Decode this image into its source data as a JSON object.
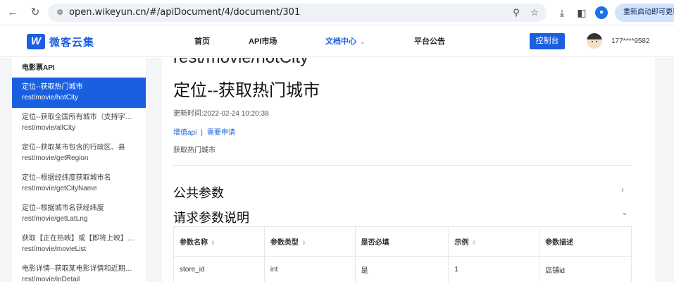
{
  "browser": {
    "url": "open.wikeyun.cn/#/apiDocument/4/document/301",
    "update_button": "重新启动即可更新"
  },
  "header": {
    "logo_mark": "W",
    "logo_text": "微客云集",
    "nav": [
      "首页",
      "API市场",
      "文档中心",
      "平台公告"
    ],
    "console": "控制台",
    "phone": "177****9582"
  },
  "sidebar": {
    "title": "电影票API",
    "items": [
      {
        "title": "定位--获取热门城市",
        "path": "rest/movie/hotCity"
      },
      {
        "title": "定位--获取全国所有城市（支持字母...",
        "path": "rest/movie/allCity"
      },
      {
        "title": "定位--获取某市包含的行政区、县",
        "path": "rest/movie/getRegion"
      },
      {
        "title": "定位--根据经纬度获取城市名",
        "path": "rest/movie/getCityName"
      },
      {
        "title": "定位--根据城市名获经纬度",
        "path": "rest/movie/getLatLng"
      },
      {
        "title": "获取【正在热映】或【即将上映】电...",
        "path": "rest/movie/movieList"
      },
      {
        "title": "电影详情--获取某电影详情和近期所...",
        "path": "rest/movie/inDetail"
      }
    ]
  },
  "doc": {
    "endpoint": "rest/movie/hotCity",
    "title": "定位--获取热门城市",
    "updated": "更新时间:2022-02-24 10:20:38",
    "link_value_api": "增值api",
    "link_separator": "|",
    "link_apply": "需要申请",
    "description": "获取热门城市",
    "section_public": "公共参数",
    "section_request": "请求参数说明",
    "chevron_right": "›",
    "chevron_down": "⌄"
  },
  "table": {
    "headers": [
      "参数名称",
      "参数类型",
      "是否必填",
      "示例",
      "参数描述"
    ],
    "rows": [
      [
        "store_id",
        "int",
        "是",
        "1",
        "店铺id"
      ]
    ]
  }
}
